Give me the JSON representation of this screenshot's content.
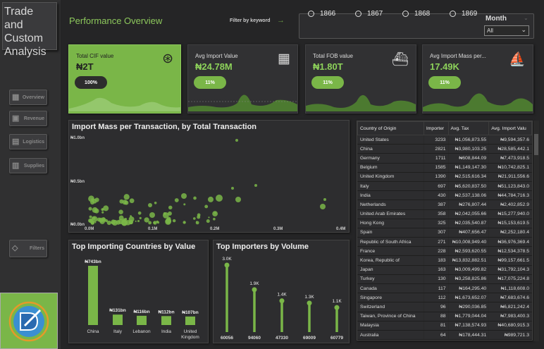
{
  "app": {
    "title": "Trade and Custom Analysis",
    "page_title": "Performance Overview"
  },
  "nav": [
    {
      "label": "Overview",
      "icon": "overview-icon"
    },
    {
      "label": "Revenue",
      "icon": "revenue-icon"
    },
    {
      "label": "Logistics",
      "icon": "logistics-icon"
    },
    {
      "label": "Supplies",
      "icon": "supplies-icon"
    }
  ],
  "filters_button": "Filters",
  "filter": {
    "label": "Filter by keyword"
  },
  "years": [
    "1866",
    "1867",
    "1868",
    "1869"
  ],
  "month": {
    "label": "Month",
    "value": "All"
  },
  "cards": {
    "cif": {
      "title": "Total CIF value",
      "value": "₦2T",
      "pill": "100%"
    },
    "import": {
      "title": "Avg Import Value",
      "value": "₦24.78M",
      "pill": "11%"
    },
    "fob": {
      "title": "Total FOB value",
      "value": "₦1.80T",
      "pill": "11%"
    },
    "mass": {
      "title": "Avg Import Mass per...",
      "value": "17.49K",
      "pill": "11%"
    }
  },
  "scatter": {
    "title": "Import Mass per Transaction, by Total Transaction",
    "y_ticks": [
      "₦1.0bn",
      "₦0.5bn",
      "₦0.0bn"
    ],
    "x_ticks": [
      "0.0M",
      "0.1M",
      "0.2M",
      "0.3M",
      "0.4M"
    ]
  },
  "bar_chart_1": {
    "title": "Top Importing Countries by Value",
    "categories": [
      "China",
      "Italy",
      "Lebanon",
      "India",
      "United Kingdom"
    ],
    "labels": [
      "₦743bn",
      "₦131bn",
      "₦116bn",
      "₦112bn",
      "₦107bn"
    ],
    "values": [
      743,
      131,
      116,
      112,
      107
    ]
  },
  "bar_chart_2": {
    "title": "Top Importers by Volume",
    "categories": [
      "60056",
      "94060",
      "47330",
      "69009",
      "60779"
    ],
    "labels": [
      "3.0K",
      "1.9K",
      "1.4K",
      "1.3K",
      "1.1K"
    ],
    "values": [
      3000,
      1900,
      1400,
      1300,
      1100
    ]
  },
  "chart_data": [
    {
      "type": "bar",
      "title": "Top Importing Countries by Value",
      "categories": [
        "China",
        "Italy",
        "Lebanon",
        "India",
        "United Kingdom"
      ],
      "values": [
        743,
        131,
        116,
        112,
        107
      ]
    },
    {
      "type": "bar",
      "title": "Top Importers by Volume",
      "categories": [
        "60056",
        "94060",
        "47330",
        "69009",
        "60779"
      ],
      "values": [
        3000,
        1900,
        1400,
        1300,
        1100
      ]
    }
  ],
  "table": {
    "headers": [
      "Country of Origin",
      "Importer",
      "Avg. Tax",
      "Avg. Import Valu"
    ],
    "rows": [
      [
        "United States",
        "3233",
        "₦1,056,873.55",
        "₦9,594,357.6"
      ],
      [
        "China",
        "2821",
        "₦3,980,103.25",
        "₦28,585,442.1"
      ],
      [
        "Germany",
        "1711",
        "₦608,844.09",
        "₦7,473,918.5"
      ],
      [
        "Belgium",
        "1585",
        "₦1,149,147.30",
        "₦10,742,825.1"
      ],
      [
        "United Kingdom",
        "1390",
        "₦2,515,616.34",
        "₦21,911,556.6"
      ],
      [
        "Italy",
        "697",
        "₦5,620,837.50",
        "₦51,123,843.0"
      ],
      [
        "India",
        "430",
        "₦2,537,138.06",
        "₦44,784,716.3"
      ],
      [
        "Netherlands",
        "387",
        "₦276,807.44",
        "₦2,402,852.9"
      ],
      [
        "United Arab Emirates",
        "358",
        "₦2,042,055.66",
        "₦15,277,940.0"
      ],
      [
        "Hong Kong",
        "325",
        "₦2,035,540.87",
        "₦15,153,619.5"
      ],
      [
        "Spain",
        "307",
        "₦407,656.47",
        "₦2,252,180.4"
      ],
      [
        "Republic of South Africa",
        "271",
        "₦10,008,949.40",
        "₦36,976,369.4"
      ],
      [
        "France",
        "228",
        "₦2,593,620.55",
        "₦12,534,378.5"
      ],
      [
        "Korea, Republic of",
        "183",
        "₦13,832,882.51",
        "₦99,157,661.5"
      ],
      [
        "Japan",
        "163",
        "₦3,009,499.82",
        "₦31,792,104.3"
      ],
      [
        "Turkey",
        "130",
        "₦3,258,825.86",
        "₦17,075,224.8"
      ],
      [
        "Canada",
        "117",
        "₦164,295.40",
        "₦1,118,608.0"
      ],
      [
        "Singapore",
        "112",
        "₦1,673,652.07",
        "₦7,683,674.6"
      ],
      [
        "Switzerland",
        "96",
        "₦290,036.85",
        "₦6,821,242.4"
      ],
      [
        "Taiwan, Province of China",
        "88",
        "₦1,779,044.04",
        "₦7,983,400.3"
      ],
      [
        "Malaysia",
        "81",
        "₦7,138,574.93",
        "₦40,680,915.3"
      ],
      [
        "Australia",
        "64",
        "₦178,444.31",
        "₦989,721.3"
      ]
    ]
  }
}
